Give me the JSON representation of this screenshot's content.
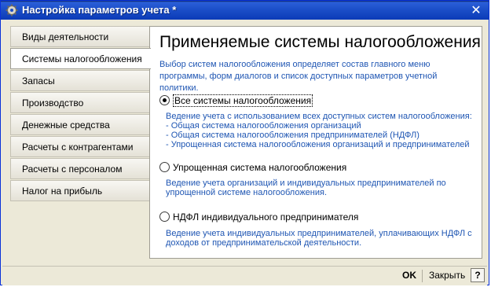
{
  "window": {
    "title": "Настройка параметров учета *",
    "icon": "gear-icon",
    "close_glyph": "✕"
  },
  "tabs": [
    {
      "label": "Виды деятельности",
      "active": false
    },
    {
      "label": "Системы налогообложения",
      "active": true
    },
    {
      "label": "Запасы",
      "active": false
    },
    {
      "label": "Производство",
      "active": false
    },
    {
      "label": "Денежные средства",
      "active": false
    },
    {
      "label": "Расчеты с контрагентами",
      "active": false
    },
    {
      "label": "Расчеты с персоналом",
      "active": false
    },
    {
      "label": "Налог на прибыль",
      "active": false
    }
  ],
  "panel": {
    "title": "Применяемые системы налогообложения",
    "description": "Выбор систем налогообложения определяет состав главного меню программы, форм диалогов и список доступных параметров учетной политики.",
    "options": [
      {
        "label": "Все системы налогообложения",
        "checked": true,
        "desc_lines": [
          "Ведение учета с использованием всех доступных систем налогообложения:",
          "- Общая система налогообложения организаций",
          "- Общая система налогообложения предпринимателей (НДФЛ)",
          "- Упрощенная система налогообложения организаций и предпринимателей"
        ]
      },
      {
        "label": "Упрощенная система налогообложения",
        "checked": false,
        "desc_lines": [
          "Ведение учета организаций и индивидуальных предпринимателей по",
          "упрощенной системе налогообложения."
        ]
      },
      {
        "label": "НДФЛ индивидуального предпринимателя",
        "checked": false,
        "desc_lines": [
          "Ведение учета индивидуальных предпринимателей, уплачивающих НДФЛ с",
          "доходов от предпринимательской деятельности."
        ]
      }
    ]
  },
  "buttons": {
    "ok": "OK",
    "close": "Закрыть",
    "help": "?"
  },
  "colors": {
    "accent_text": "#1f56b3",
    "titlebar": "#1c4fc9"
  }
}
